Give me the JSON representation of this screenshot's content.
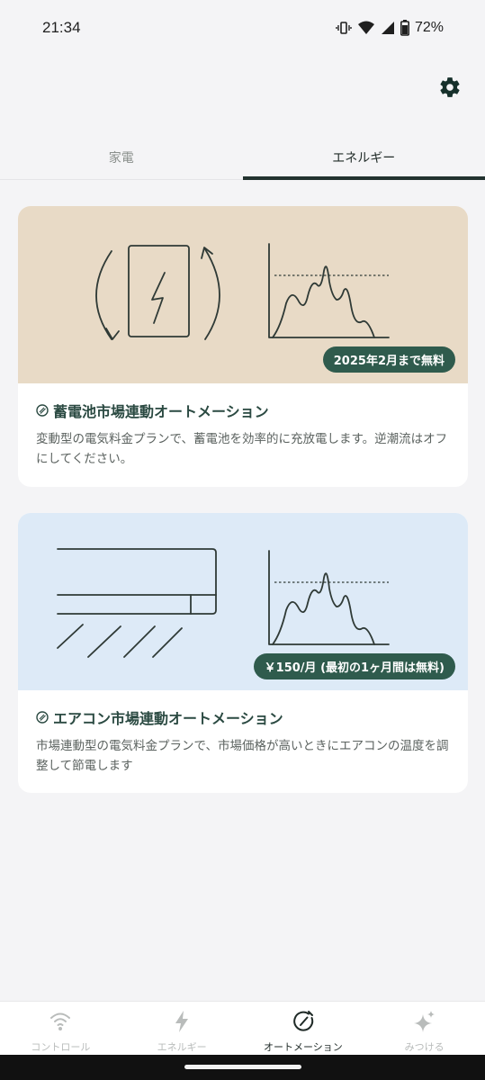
{
  "status_bar": {
    "time": "21:34",
    "battery": "72%"
  },
  "tabs": [
    {
      "label": "家電",
      "active": false
    },
    {
      "label": "エネルギー",
      "active": true
    }
  ],
  "cards": [
    {
      "badge": "2025年2月まで無料",
      "title": "蓄電池市場連動オートメーション",
      "description": "変動型の電気料金プランで、蓄電池を効率的に充放電します。逆潮流はオフにしてください。",
      "background": "#e8dac6"
    },
    {
      "badge": "￥150/月 (最初の1ヶ月間は無料)",
      "title": "エアコン市場連動オートメーション",
      "description": "市場連動型の電気料金プランで、市場価格が高いときにエアコンの温度を調整して節電します",
      "background": "#ddeaf7"
    }
  ],
  "bottom_nav": [
    {
      "label": "コントロール",
      "icon": "wifi-control-icon",
      "active": false
    },
    {
      "label": "エネルギー",
      "icon": "lightning-icon",
      "active": false
    },
    {
      "label": "オートメーション",
      "icon": "automation-gauge-icon",
      "active": true
    },
    {
      "label": "みつける",
      "icon": "sparkle-icon",
      "active": false
    }
  ],
  "colors": {
    "accent": "#2f5b4d",
    "tab_indicator": "#22322f"
  }
}
